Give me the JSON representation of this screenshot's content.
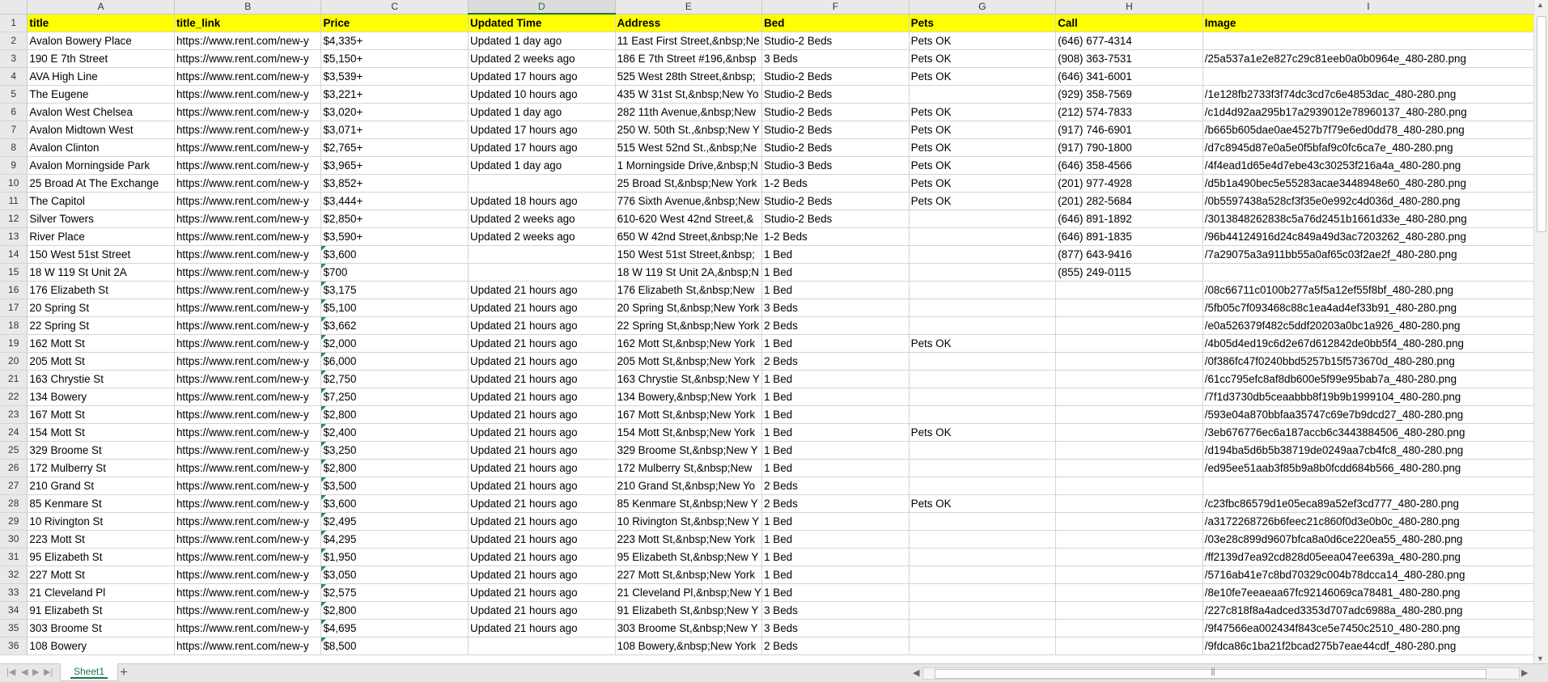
{
  "columns": [
    "A",
    "B",
    "C",
    "D",
    "E",
    "F",
    "G",
    "H",
    "I"
  ],
  "selected_column": "D",
  "header": {
    "row_num": "1",
    "cells": [
      "title",
      "title_link",
      "Price",
      "Updated Time",
      "Address",
      "Bed",
      "Pets",
      "Call",
      "Image"
    ]
  },
  "rows": [
    {
      "n": "2",
      "cells": [
        "Avalon Bowery Place",
        "https://www.rent.com/new-y",
        "$4,335+",
        "Updated 1 day ago",
        "11 East First Street,&nbsp;Ne",
        "Studio-2 Beds",
        "Pets OK",
        "(646) 677-4314",
        ""
      ]
    },
    {
      "n": "3",
      "cells": [
        "190 E 7th Street",
        "https://www.rent.com/new-y",
        "$5,150+",
        "Updated 2 weeks ago",
        "186 E 7th Street #196,&nbsp",
        "3 Beds",
        "Pets OK",
        "(908) 363-7531",
        "/25a537a1e2e827c29c81eeb0a0b0964e_480-280.png"
      ]
    },
    {
      "n": "4",
      "cells": [
        "AVA High Line",
        "https://www.rent.com/new-y",
        "$3,539+",
        "Updated 17 hours ago",
        "525 West 28th Street,&nbsp;",
        "Studio-2 Beds",
        "Pets OK",
        "(646) 341-6001",
        ""
      ]
    },
    {
      "n": "5",
      "cells": [
        "The Eugene",
        "https://www.rent.com/new-y",
        "$3,221+",
        "Updated 10 hours ago",
        "435 W 31st St,&nbsp;New Yo",
        "Studio-2 Beds",
        "",
        "(929) 358-7569",
        "/1e128fb2733f3f74dc3cd7c6e4853dac_480-280.png"
      ]
    },
    {
      "n": "6",
      "cells": [
        "Avalon West Chelsea",
        "https://www.rent.com/new-y",
        "$3,020+",
        "Updated 1 day ago",
        "282 11th Avenue,&nbsp;New",
        "Studio-2 Beds",
        "Pets OK",
        "(212) 574-7833",
        "/c1d4d92aa295b17a2939012e78960137_480-280.png"
      ]
    },
    {
      "n": "7",
      "cells": [
        "Avalon Midtown West",
        "https://www.rent.com/new-y",
        "$3,071+",
        "Updated 17 hours ago",
        "250 W. 50th St.,&nbsp;New Y",
        "Studio-2 Beds",
        "Pets OK",
        "(917) 746-6901",
        "/b665b605dae0ae4527b7f79e6ed0dd78_480-280.png"
      ]
    },
    {
      "n": "8",
      "cells": [
        "Avalon Clinton",
        "https://www.rent.com/new-y",
        "$2,765+",
        "Updated 17 hours ago",
        "515 West 52nd St.,&nbsp;Ne",
        "Studio-2 Beds",
        "Pets OK",
        "(917) 790-1800",
        "/d7c8945d87e0a5e0f5bfaf9c0fc6ca7e_480-280.png"
      ]
    },
    {
      "n": "9",
      "cells": [
        "Avalon Morningside Park",
        "https://www.rent.com/new-y",
        "$3,965+",
        "Updated 1 day ago",
        "1 Morningside Drive,&nbsp;N",
        "Studio-3 Beds",
        "Pets OK",
        "(646) 358-4566",
        "/4f4ead1d65e4d7ebe43c30253f216a4a_480-280.png"
      ]
    },
    {
      "n": "10",
      "cells": [
        "25 Broad At The Exchange",
        "https://www.rent.com/new-y",
        "$3,852+",
        "",
        "25 Broad St,&nbsp;New York",
        "1-2 Beds",
        "Pets OK",
        "(201) 977-4928",
        "/d5b1a490bec5e55283acae3448948e60_480-280.png"
      ]
    },
    {
      "n": "11",
      "cells": [
        "The Capitol",
        "https://www.rent.com/new-y",
        "$3,444+",
        "Updated 18 hours ago",
        "776 Sixth Avenue,&nbsp;New",
        "Studio-2 Beds",
        "Pets OK",
        "(201) 282-5684",
        "/0b5597438a528cf3f35e0e992c4d036d_480-280.png"
      ]
    },
    {
      "n": "12",
      "cells": [
        "Silver Towers",
        "https://www.rent.com/new-y",
        "$2,850+",
        "Updated 2 weeks ago",
        "610-620 West 42nd Street,&",
        "Studio-2 Beds",
        "",
        "(646) 891-1892",
        "/3013848262838c5a76d2451b1661d33e_480-280.png"
      ]
    },
    {
      "n": "13",
      "cells": [
        "River Place",
        "https://www.rent.com/new-y",
        "$3,590+",
        "Updated 2 weeks ago",
        "650 W 42nd Street,&nbsp;Ne",
        "1-2 Beds",
        "",
        "(646) 891-1835",
        "/96b44124916d24c849a49d3ac7203262_480-280.png"
      ]
    },
    {
      "n": "14",
      "cells": [
        "150 West 51st Street",
        "https://www.rent.com/new-y",
        "$3,600",
        "",
        "150 West 51st Street,&nbsp;",
        "1 Bed",
        "",
        "(877) 643-9416",
        "/7a29075a3a911bb55a0af65c03f2ae2f_480-280.png"
      ]
    },
    {
      "n": "15",
      "cells": [
        "18 W 119 St Unit 2A",
        "https://www.rent.com/new-y",
        "$700",
        "",
        "18 W 119 St Unit 2A,&nbsp;N",
        "1 Bed",
        "",
        "(855) 249-0115",
        ""
      ]
    },
    {
      "n": "16",
      "cells": [
        "176 Elizabeth St",
        "https://www.rent.com/new-y",
        "$3,175",
        "Updated 21 hours ago",
        "176 Elizabeth St,&nbsp;New",
        "1 Bed",
        "",
        "",
        "/08c66711c0100b277a5f5a12ef55f8bf_480-280.png"
      ]
    },
    {
      "n": "17",
      "cells": [
        "20 Spring St",
        "https://www.rent.com/new-y",
        "$5,100",
        "Updated 21 hours ago",
        "20 Spring St,&nbsp;New York",
        "3 Beds",
        "",
        "",
        "/5fb05c7f093468c88c1ea4ad4ef33b91_480-280.png"
      ]
    },
    {
      "n": "18",
      "cells": [
        "22 Spring St",
        "https://www.rent.com/new-y",
        "$3,662",
        "Updated 21 hours ago",
        "22 Spring St,&nbsp;New York",
        "2 Beds",
        "",
        "",
        "/e0a526379f482c5ddf20203a0bc1a926_480-280.png"
      ]
    },
    {
      "n": "19",
      "cells": [
        "162 Mott St",
        "https://www.rent.com/new-y",
        "$2,000",
        "Updated 21 hours ago",
        "162 Mott St,&nbsp;New York",
        "1 Bed",
        "Pets OK",
        "",
        "/4b05d4ed19c6d2e67d612842de0bb5f4_480-280.png"
      ]
    },
    {
      "n": "20",
      "cells": [
        "205 Mott St",
        "https://www.rent.com/new-y",
        "$6,000",
        "Updated 21 hours ago",
        "205 Mott St,&nbsp;New York",
        "2 Beds",
        "",
        "",
        "/0f386fc47f0240bbd5257b15f573670d_480-280.png"
      ]
    },
    {
      "n": "21",
      "cells": [
        "163 Chrystie St",
        "https://www.rent.com/new-y",
        "$2,750",
        "Updated 21 hours ago",
        "163 Chrystie St,&nbsp;New Y",
        "1 Bed",
        "",
        "",
        "/61cc795efc8af8db600e5f99e95bab7a_480-280.png"
      ]
    },
    {
      "n": "22",
      "cells": [
        "134 Bowery",
        "https://www.rent.com/new-y",
        "$7,250",
        "Updated 21 hours ago",
        "134 Bowery,&nbsp;New York",
        "1 Bed",
        "",
        "",
        "/7f1d3730db5ceaabbb8f19b9b1999104_480-280.png"
      ]
    },
    {
      "n": "23",
      "cells": [
        "167 Mott St",
        "https://www.rent.com/new-y",
        "$2,800",
        "Updated 21 hours ago",
        "167 Mott St,&nbsp;New York",
        "1 Bed",
        "",
        "",
        "/593e04a870bbfaa35747c69e7b9dcd27_480-280.png"
      ]
    },
    {
      "n": "24",
      "cells": [
        "154 Mott St",
        "https://www.rent.com/new-y",
        "$2,400",
        "Updated 21 hours ago",
        "154 Mott St,&nbsp;New York",
        "1 Bed",
        "Pets OK",
        "",
        "/3eb676776ec6a187accb6c3443884506_480-280.png"
      ]
    },
    {
      "n": "25",
      "cells": [
        "329 Broome St",
        "https://www.rent.com/new-y",
        "$3,250",
        "Updated 21 hours ago",
        "329 Broome St,&nbsp;New Y",
        "1 Bed",
        "",
        "",
        "/d194ba5d6b5b38719de0249aa7cb4fc8_480-280.png"
      ]
    },
    {
      "n": "26",
      "cells": [
        "172 Mulberry St",
        "https://www.rent.com/new-y",
        "$2,800",
        "Updated 21 hours ago",
        "172 Mulberry St,&nbsp;New",
        "1 Bed",
        "",
        "",
        "/ed95ee51aab3f85b9a8b0fcdd684b566_480-280.png"
      ]
    },
    {
      "n": "27",
      "cells": [
        "210 Grand St",
        "https://www.rent.com/new-y",
        "$3,500",
        "Updated 21 hours ago",
        "210 Grand St,&nbsp;New Yo",
        "2 Beds",
        "",
        "",
        ""
      ]
    },
    {
      "n": "28",
      "cells": [
        "85 Kenmare St",
        "https://www.rent.com/new-y",
        "$3,600",
        "Updated 21 hours ago",
        "85 Kenmare St,&nbsp;New Y",
        "2 Beds",
        "Pets OK",
        "",
        "/c23fbc86579d1e05eca89a52ef3cd777_480-280.png"
      ]
    },
    {
      "n": "29",
      "cells": [
        "10 Rivington St",
        "https://www.rent.com/new-y",
        "$2,495",
        "Updated 21 hours ago",
        "10 Rivington St,&nbsp;New Y",
        "1 Bed",
        "",
        "",
        "/a3172268726b6feec21c860f0d3e0b0c_480-280.png"
      ]
    },
    {
      "n": "30",
      "cells": [
        "223 Mott St",
        "https://www.rent.com/new-y",
        "$4,295",
        "Updated 21 hours ago",
        "223 Mott St,&nbsp;New York",
        "1 Bed",
        "",
        "",
        "/03e28c899d9607bfca8a0d6ce220ea55_480-280.png"
      ]
    },
    {
      "n": "31",
      "cells": [
        "95 Elizabeth St",
        "https://www.rent.com/new-y",
        "$1,950",
        "Updated 21 hours ago",
        "95 Elizabeth St,&nbsp;New Y",
        "1 Bed",
        "",
        "",
        "/ff2139d7ea92cd828d05eea047ee639a_480-280.png"
      ]
    },
    {
      "n": "32",
      "cells": [
        "227 Mott St",
        "https://www.rent.com/new-y",
        "$3,050",
        "Updated 21 hours ago",
        "227 Mott St,&nbsp;New York",
        "1 Bed",
        "",
        "",
        "/5716ab41e7c8bd70329c004b78dcca14_480-280.png"
      ]
    },
    {
      "n": "33",
      "cells": [
        "21 Cleveland Pl",
        "https://www.rent.com/new-y",
        "$2,575",
        "Updated 21 hours ago",
        "21 Cleveland Pl,&nbsp;New Y",
        "1 Bed",
        "",
        "",
        "/8e10fe7eeaeaa67fc92146069ca78481_480-280.png"
      ]
    },
    {
      "n": "34",
      "cells": [
        "91 Elizabeth St",
        "https://www.rent.com/new-y",
        "$2,800",
        "Updated 21 hours ago",
        "91 Elizabeth St,&nbsp;New Y",
        "3 Beds",
        "",
        "",
        "/227c818f8a4adced3353d707adc6988a_480-280.png"
      ]
    },
    {
      "n": "35",
      "cells": [
        "303 Broome St",
        "https://www.rent.com/new-y",
        "$4,695",
        "Updated 21 hours ago",
        "303 Broome St,&nbsp;New Y",
        "3 Beds",
        "",
        "",
        "/9f47566ea002434f843ce5e7450c2510_480-280.png"
      ]
    },
    {
      "n": "36",
      "cells": [
        "108 Bowery",
        "https://www.rent.com/new-y",
        "$8,500",
        "",
        "108 Bowery,&nbsp;New York",
        "2 Beds",
        "",
        "",
        "/9fdca86c1ba21f2bcad275b7eae44cdf_480-280.png"
      ]
    }
  ],
  "sheet_tab": "Sheet1",
  "add_sheet_icon": "+",
  "icons": {
    "nav_first": "first-sheet-icon",
    "nav_prev": "prev-sheet-icon",
    "nav_next": "next-sheet-icon",
    "nav_last": "last-sheet-icon"
  },
  "colors": {
    "header_fill": "#ffff00",
    "accent": "#217346",
    "gridline": "#d4d4d4"
  }
}
